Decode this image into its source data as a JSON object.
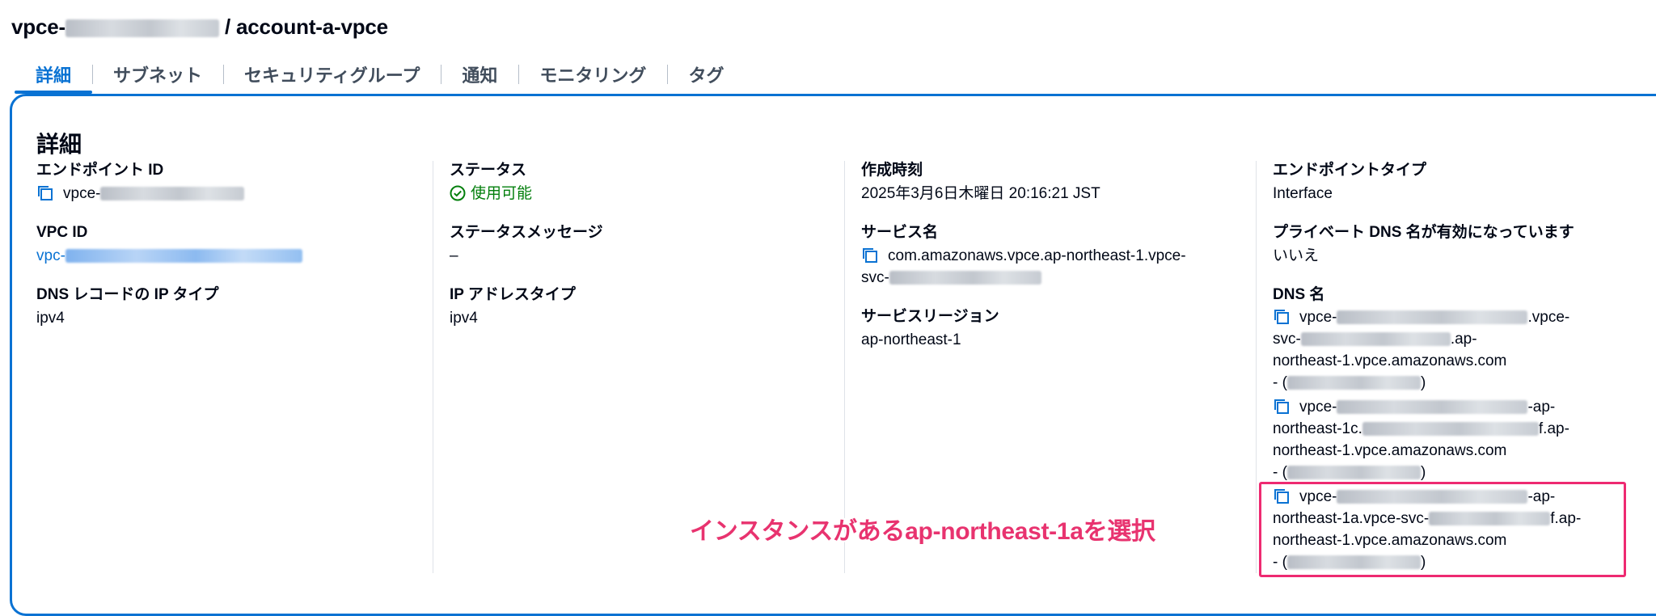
{
  "header": {
    "title_prefix": "vpce-",
    "title_suffix": " / account-a-vpce"
  },
  "tabs": [
    {
      "label": "詳細",
      "active": true
    },
    {
      "label": "サブネット",
      "active": false
    },
    {
      "label": "セキュリティグループ",
      "active": false
    },
    {
      "label": "通知",
      "active": false
    },
    {
      "label": "モニタリング",
      "active": false
    },
    {
      "label": "タグ",
      "active": false
    }
  ],
  "details": {
    "heading": "詳細",
    "endpoint_id": {
      "label": "エンドポイント ID",
      "value_prefix": "vpce-"
    },
    "vpc_id": {
      "label": "VPC ID",
      "value_prefix": "vpc-"
    },
    "dns_record_ip_type": {
      "label": "DNS レコードの IP タイプ",
      "value": "ipv4"
    },
    "status": {
      "label": "ステータス",
      "value": "使用可能",
      "color": "#037f0c"
    },
    "status_message": {
      "label": "ステータスメッセージ",
      "value": "–"
    },
    "ip_address_type": {
      "label": "IP アドレスタイプ",
      "value": "ipv4"
    },
    "created": {
      "label": "作成時刻",
      "value": "2025年3月6日木曜日 20:16:21 JST"
    },
    "service_name": {
      "label": "サービス名",
      "line1": "com.amazonaws.vpce.ap-northeast-1.vpce-",
      "line2_prefix": "svc-"
    },
    "service_region": {
      "label": "サービスリージョン",
      "value": "ap-northeast-1"
    },
    "endpoint_type": {
      "label": "エンドポイントタイプ",
      "value": "Interface"
    },
    "private_dns": {
      "label": "プライベート DNS 名が有効になっています",
      "value": "いいえ"
    },
    "dns_names": {
      "label": "DNS 名",
      "entries": [
        {
          "l1a": "vpce-",
          "l1b": ".vpce-",
          "l2a": "svc-",
          "l2b": ".ap-",
          "l3": "northeast-1.vpce.amazonaws.com",
          "l4": "- ("
        },
        {
          "l1a": "vpce-",
          "l1b": "-ap-",
          "l2a": "northeast-1c.",
          "l2b": "f.ap-",
          "l3": "northeast-1.vpce.amazonaws.com",
          "l4": "- ("
        },
        {
          "l1a": "vpce-",
          "l1b": "-ap-",
          "l2a": "northeast-1a.vpce-svc-",
          "l2b": "f.ap-",
          "l3": "northeast-1.vpce.amazonaws.com",
          "l4": "- ("
        }
      ]
    }
  },
  "annotation": {
    "text": "インスタンスがあるap-northeast-1aを選択",
    "color": "#e8336f"
  },
  "colors": {
    "accent": "#0972d3",
    "highlight": "#ee2a71",
    "text": "#000716"
  },
  "icons": {
    "copy": "copy-icon",
    "status": "check-circle-icon"
  }
}
